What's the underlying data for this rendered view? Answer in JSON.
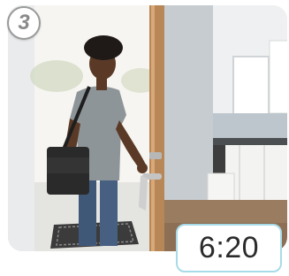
{
  "step": {
    "number": "3"
  },
  "time": {
    "display": "6:20"
  },
  "photo": {
    "subject": "woman-unlocking-front-door"
  },
  "colors": {
    "time_border": "#a8dbe9",
    "badge_border": "#9a9a9a"
  }
}
